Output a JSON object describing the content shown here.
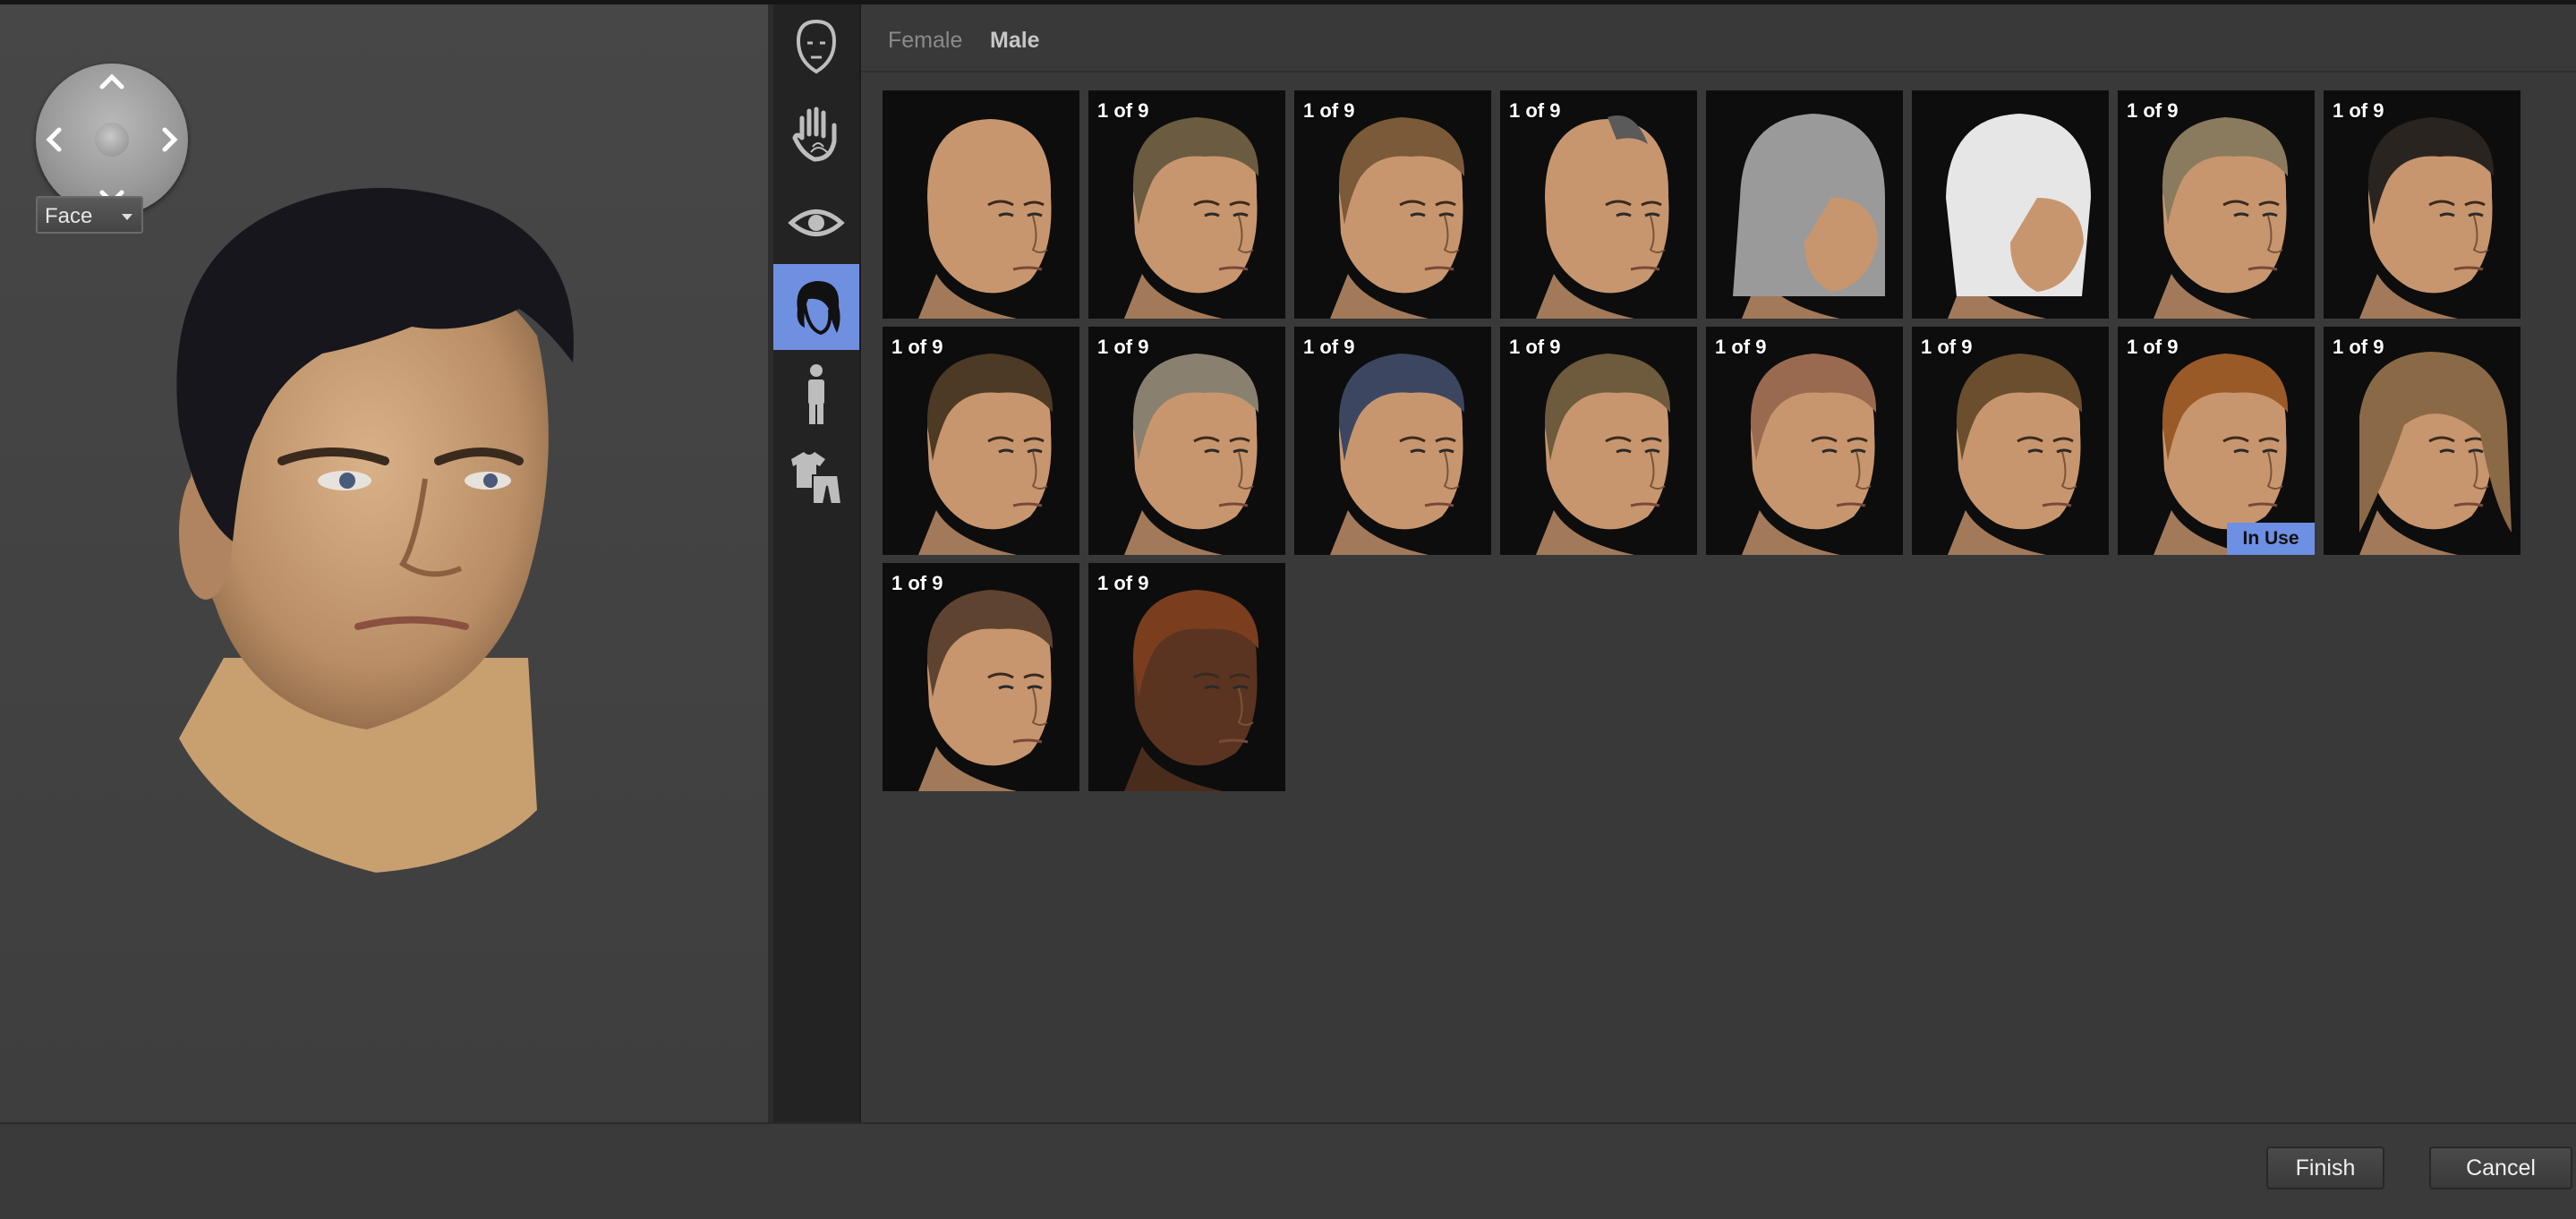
{
  "preview": {
    "view_select": {
      "value": "Face"
    }
  },
  "toolstrip": {
    "tools": [
      {
        "name": "face-tool",
        "icon": "face-icon"
      },
      {
        "name": "skin-tool",
        "icon": "hand-fingerprint-icon"
      },
      {
        "name": "eyes-tool",
        "icon": "eye-icon"
      },
      {
        "name": "hair-tool",
        "icon": "hair-icon",
        "active": true
      },
      {
        "name": "body-tool",
        "icon": "person-icon"
      },
      {
        "name": "clothing-tool",
        "icon": "clothing-icon"
      }
    ]
  },
  "tabs": {
    "female": "Female",
    "male": "Male",
    "active": "male"
  },
  "hair_grid": [
    {
      "count": "",
      "style": "bald",
      "hair": "#c48b6d"
    },
    {
      "count": "1 of 9",
      "style": "short",
      "hair": "#6b5b40"
    },
    {
      "count": "1 of 9",
      "style": "short",
      "hair": "#7a5a38"
    },
    {
      "count": "1 of 9",
      "style": "mohawk",
      "hair": "#5a5a5a"
    },
    {
      "count": "",
      "style": "helmet-silver",
      "hair": "#9a9a9a"
    },
    {
      "count": "",
      "style": "helmet-white",
      "hair": "#e6e6e6"
    },
    {
      "count": "1 of 9",
      "style": "fringe",
      "hair": "#8a7a5e"
    },
    {
      "count": "1 of 9",
      "style": "braids",
      "hair": "#2a2420"
    },
    {
      "count": "1 of 9",
      "style": "short",
      "hair": "#4d3a24"
    },
    {
      "count": "1 of 9",
      "style": "short",
      "hair": "#8a8070"
    },
    {
      "count": "1 of 9",
      "style": "short",
      "hair": "#3c4660"
    },
    {
      "count": "1 of 9",
      "style": "curly",
      "hair": "#6e5a3c"
    },
    {
      "count": "1 of 9",
      "style": "buzz",
      "hair": "#9a6a50"
    },
    {
      "count": "1 of 9",
      "style": "short",
      "hair": "#6a4e2e"
    },
    {
      "count": "1 of 9",
      "style": "spiky",
      "hair": "#9a5a28",
      "in_use": "In Use"
    },
    {
      "count": "1 of 9",
      "style": "long",
      "hair": "#8a6a46"
    },
    {
      "count": "1 of 9",
      "style": "receding",
      "hair": "#5e4430"
    },
    {
      "count": "1 of 9",
      "style": "curly-dark",
      "hair": "#7a3e1e",
      "skin": "#5a3420"
    }
  ],
  "footer": {
    "finish": "Finish",
    "cancel": "Cancel"
  },
  "colors": {
    "accent": "#6f8fe0",
    "in_use_badge": "#6d8fe4"
  }
}
